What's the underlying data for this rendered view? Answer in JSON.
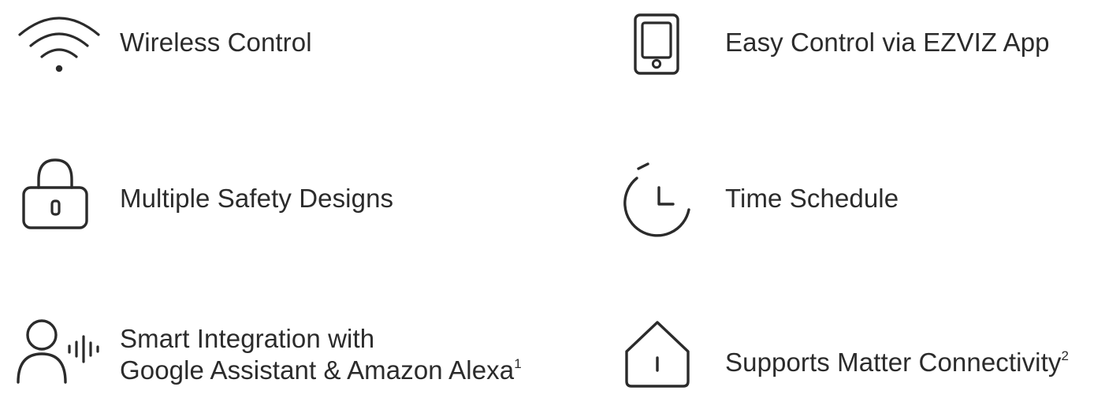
{
  "features": [
    {
      "id": "wireless",
      "icon": "wifi-icon",
      "label": "Wireless Control"
    },
    {
      "id": "app",
      "icon": "phone-icon",
      "label": "Easy Control via EZVIZ App"
    },
    {
      "id": "safety",
      "icon": "padlock-icon",
      "label": "Multiple Safety Designs"
    },
    {
      "id": "schedule",
      "icon": "clock-icon",
      "label": "Time Schedule"
    },
    {
      "id": "voice",
      "icon": "voice-user-icon",
      "label_line1": "Smart Integration with",
      "label_line2": "Google Assistant & Amazon Alexa",
      "footnote": "1"
    },
    {
      "id": "matter",
      "icon": "house-icon",
      "label": "Supports Matter Connectivity",
      "footnote": "2"
    }
  ],
  "colors": {
    "text": "#2b2b2b",
    "icon": "#2b2b2b",
    "background": "#ffffff"
  }
}
